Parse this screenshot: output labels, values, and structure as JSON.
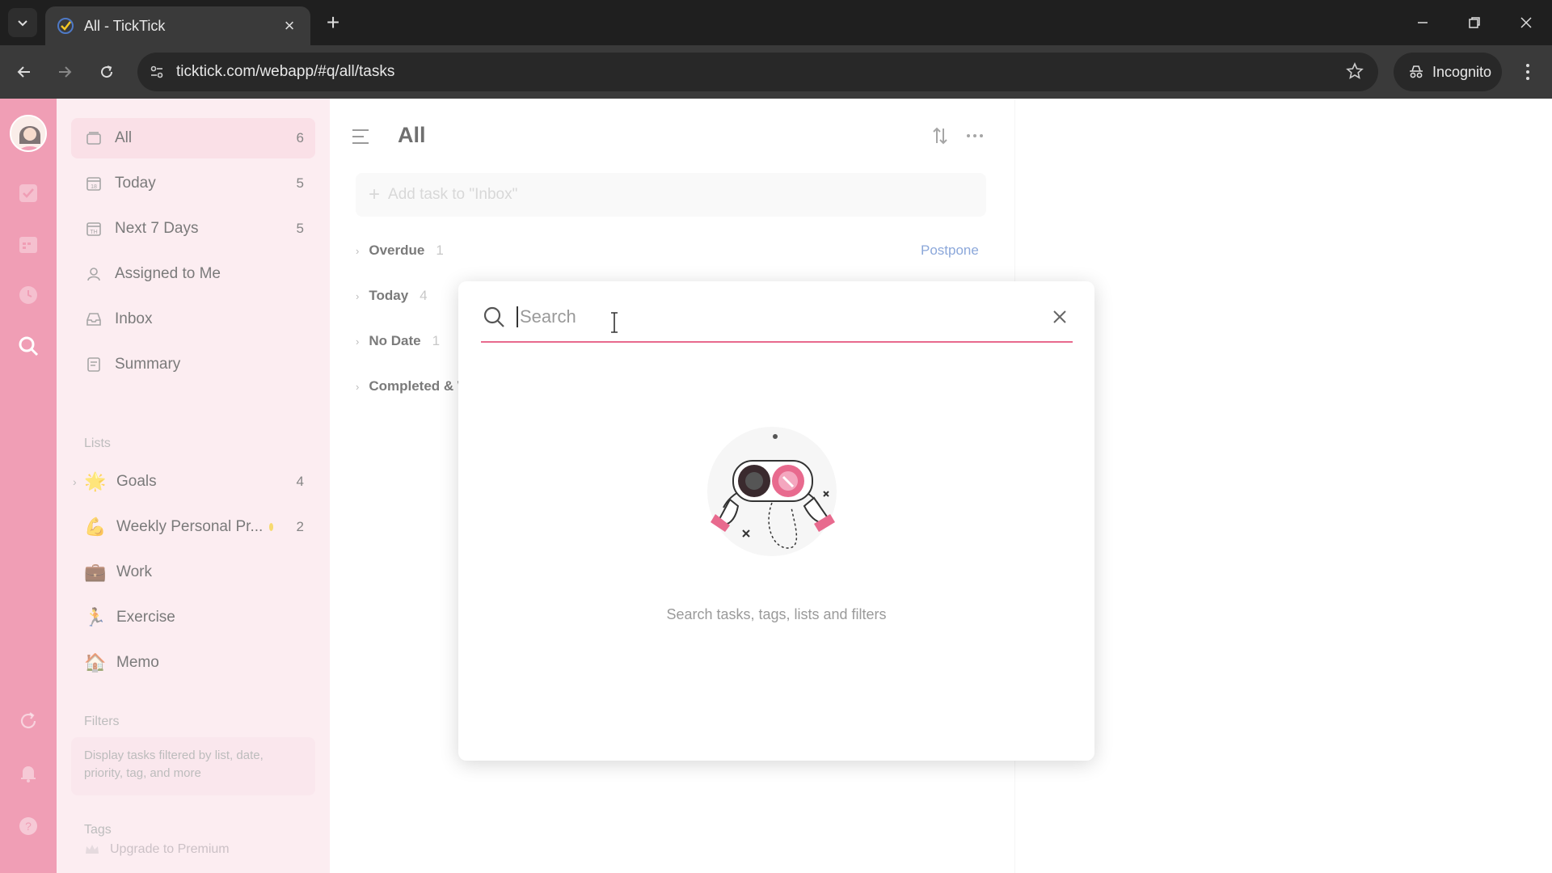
{
  "browser": {
    "tab_title": "All - TickTick",
    "url": "ticktick.com/webapp/#q/all/tasks",
    "incognito_label": "Incognito"
  },
  "sidebar": {
    "smart_lists": [
      {
        "label": "All",
        "count": "6",
        "icon": "all-icon"
      },
      {
        "label": "Today",
        "count": "5",
        "icon": "calendar-today-icon"
      },
      {
        "label": "Next 7 Days",
        "count": "5",
        "icon": "calendar-week-icon"
      },
      {
        "label": "Assigned to Me",
        "count": "",
        "icon": "person-icon"
      },
      {
        "label": "Inbox",
        "count": "",
        "icon": "inbox-icon"
      },
      {
        "label": "Summary",
        "count": "",
        "icon": "summary-icon"
      }
    ],
    "lists_title": "Lists",
    "lists": [
      {
        "label": "Goals",
        "count": "4",
        "emoji": "🌟"
      },
      {
        "label": "Weekly Personal Pr...",
        "count": "2",
        "emoji": "💪"
      },
      {
        "label": "Work",
        "count": "",
        "emoji": "💼"
      },
      {
        "label": "Exercise",
        "count": "",
        "emoji": "🏃"
      },
      {
        "label": "Memo",
        "count": "",
        "emoji": "🏠"
      }
    ],
    "filters_title": "Filters",
    "filters_hint": "Display tasks filtered by list, date, priority, tag, and more",
    "tags_title": "Tags",
    "premium_label": "Upgrade to Premium"
  },
  "main": {
    "title": "All",
    "add_task_placeholder": "Add task to \"Inbox\"",
    "postpone_label": "Postpone",
    "groups": [
      {
        "label": "Overdue",
        "count": "1"
      },
      {
        "label": "Today",
        "count": "4"
      },
      {
        "label": "No Date",
        "count": "1"
      },
      {
        "label": "Completed & W",
        "count": ""
      }
    ]
  },
  "search_modal": {
    "placeholder": "Search",
    "empty_text": "Search tasks, tags, lists and filters"
  },
  "colors": {
    "accent": "#e86a8e",
    "sidebar_bg": "#fbe3ea",
    "link": "#4e79c6"
  }
}
